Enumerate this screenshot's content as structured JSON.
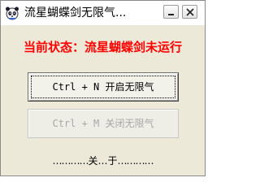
{
  "window": {
    "title": "流星蝴蝶剑无限气..."
  },
  "titlebar": {
    "app_icon": "panda-icon",
    "minimize_icon": "minimize-icon",
    "close_icon": "close-icon"
  },
  "status": {
    "text": "当前状态：流星蝴蝶剑未运行",
    "color": "#ff0000"
  },
  "buttons": {
    "start_label": "Ctrl + N  开启无限气",
    "stop_label": "Ctrl + M  关闭无限气",
    "stop_enabled": false
  },
  "about": {
    "left_dots": "…………",
    "label": "关…于",
    "right_dots": "…………"
  }
}
